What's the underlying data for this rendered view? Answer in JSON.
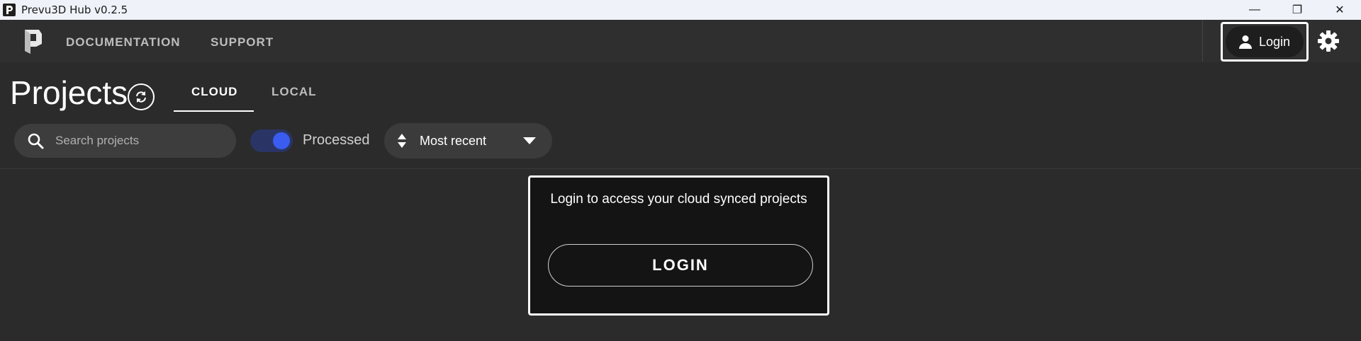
{
  "window": {
    "title": "Prevu3D Hub v0.2.5",
    "minimize_glyph": "—",
    "restore_glyph": "❐",
    "close_glyph": "✕"
  },
  "header": {
    "nav": [
      {
        "label": "DOCUMENTATION"
      },
      {
        "label": "SUPPORT"
      }
    ],
    "login_label": "Login",
    "settings_icon": "gear-icon"
  },
  "projects": {
    "title": "Projects",
    "tabs": [
      {
        "label": "CLOUD",
        "active": true
      },
      {
        "label": "LOCAL",
        "active": false
      }
    ],
    "search": {
      "placeholder": "Search projects",
      "value": ""
    },
    "processed_toggle": {
      "label": "Processed",
      "on": true
    },
    "sort": {
      "selected": "Most recent"
    }
  },
  "login_card": {
    "message": "Login to access your cloud synced projects",
    "button_label": "LOGIN"
  },
  "colors": {
    "background": "#2b2b2b",
    "header": "#2f2f2f",
    "accent": "#3a5cf0",
    "card": "#141414"
  }
}
